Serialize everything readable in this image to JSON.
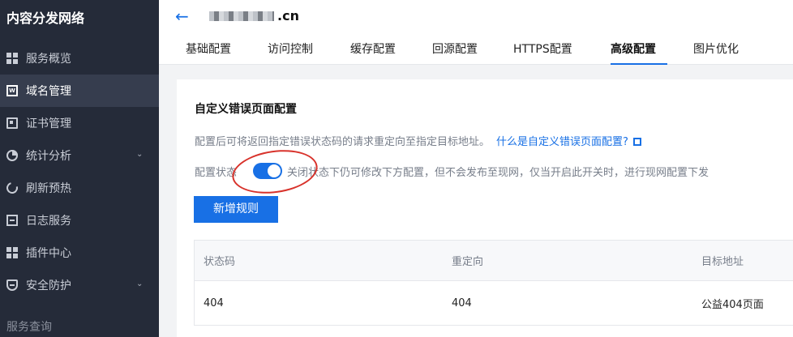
{
  "sidebar": {
    "brand": "内容分发网络",
    "items": [
      {
        "label": "服务概览",
        "icon": "grid-icon"
      },
      {
        "label": "域名管理",
        "icon": "www-icon",
        "active": true
      },
      {
        "label": "证书管理",
        "icon": "certificate-icon"
      },
      {
        "label": "统计分析",
        "icon": "pie-chart-icon",
        "expandable": true
      },
      {
        "label": "刷新预热",
        "icon": "refresh-icon"
      },
      {
        "label": "日志服务",
        "icon": "log-icon"
      },
      {
        "label": "插件中心",
        "icon": "grid-icon"
      },
      {
        "label": "安全防护",
        "icon": "shield-icon",
        "expandable": true
      }
    ],
    "section_label": "服务查询"
  },
  "header": {
    "domain_suffix": ".cn",
    "tabs": [
      {
        "label": "基础配置"
      },
      {
        "label": "访问控制"
      },
      {
        "label": "缓存配置"
      },
      {
        "label": "回源配置"
      },
      {
        "label": "HTTPS配置"
      },
      {
        "label": "高级配置",
        "active": true
      },
      {
        "label": "图片优化"
      }
    ]
  },
  "card": {
    "title": "自定义错误页面配置",
    "description": "配置后可将返回指定错误状态码的请求重定向至指定目标地址。",
    "help_link": "什么是自定义错误页面配置?",
    "status_label": "配置状态",
    "toggle_on": true,
    "status_hint": "关闭状态下仍可修改下方配置，但不会发布至现网，仅当开启此开关时，进行现网配置下发",
    "add_button": "新增规则",
    "table": {
      "columns": [
        "状态码",
        "重定向",
        "目标地址"
      ],
      "rows": [
        [
          "404",
          "404",
          "公益404页面"
        ]
      ]
    }
  },
  "colors": {
    "sidebar_bg": "#252b39",
    "accent": "#1870e5",
    "annotation": "#d8322b"
  }
}
